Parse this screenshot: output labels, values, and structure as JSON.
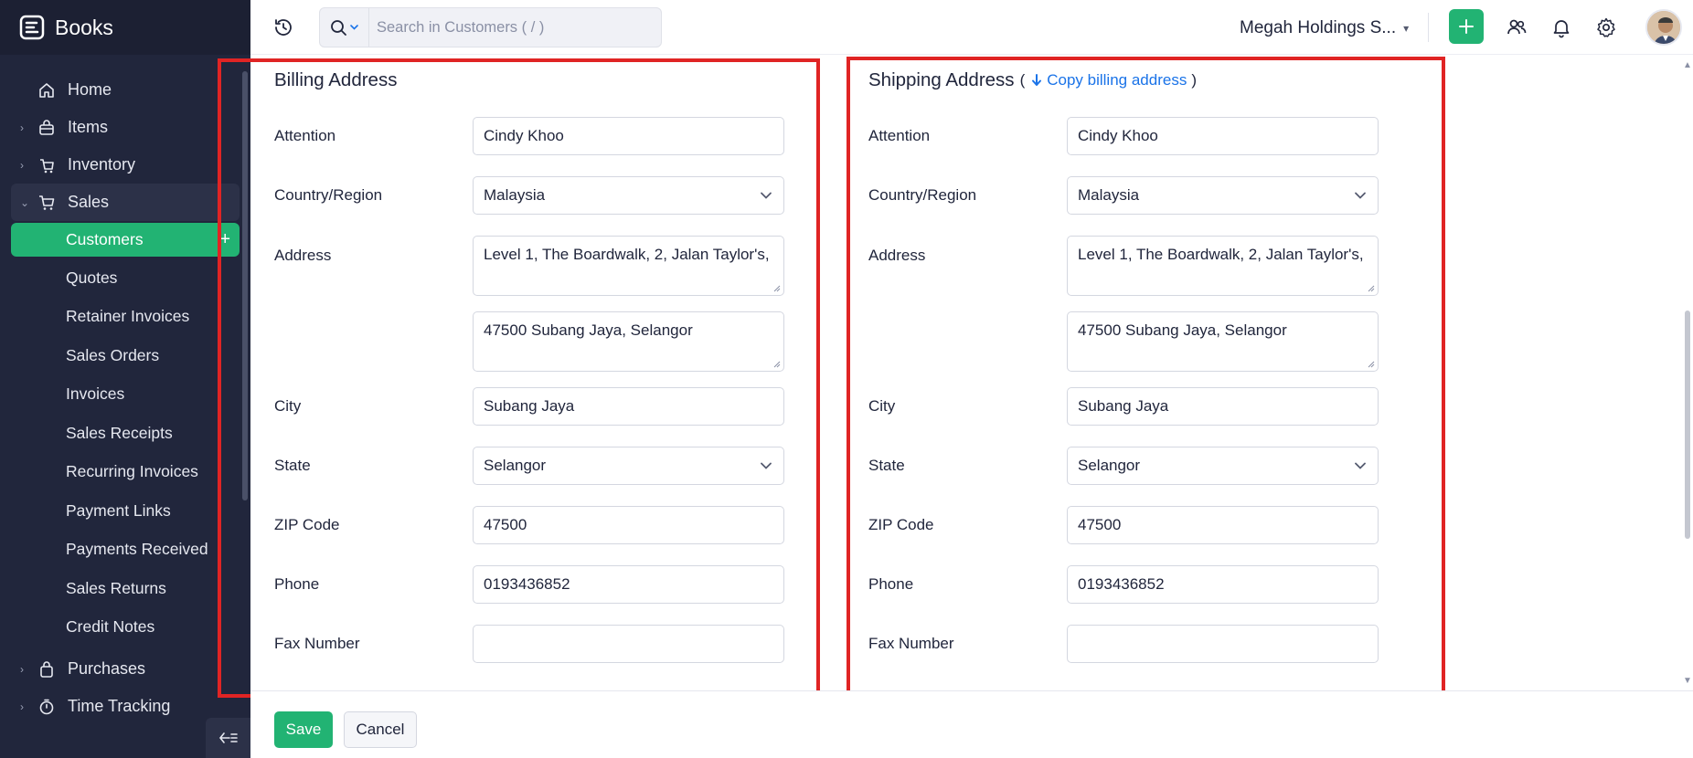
{
  "app": {
    "name": "Books"
  },
  "colors": {
    "accent": "#22b373",
    "sidebar_bg": "#21263c",
    "link": "#1a73e8",
    "highlight_box": "#e02424"
  },
  "sidebar": {
    "items": [
      {
        "label": "Home",
        "icon": "home-icon"
      },
      {
        "label": "Items",
        "icon": "basket-icon"
      },
      {
        "label": "Inventory",
        "icon": "box-icon"
      },
      {
        "label": "Sales",
        "icon": "cart-icon"
      },
      {
        "label": "Purchases",
        "icon": "bag-icon"
      },
      {
        "label": "Time Tracking",
        "icon": "timer-icon"
      }
    ],
    "sales_sub": [
      "Customers",
      "Quotes",
      "Retainer Invoices",
      "Sales Orders",
      "Invoices",
      "Sales Receipts",
      "Recurring Invoices",
      "Payment Links",
      "Payments Received",
      "Sales Returns",
      "Credit Notes"
    ],
    "add_symbol": "+"
  },
  "header": {
    "search_placeholder": "Search in Customers ( / )",
    "org_name": "Megah Holdings S..."
  },
  "billing": {
    "title": "Billing Address",
    "labels": {
      "attention": "Attention",
      "country": "Country/Region",
      "address": "Address",
      "city": "City",
      "state": "State",
      "zip": "ZIP Code",
      "phone": "Phone",
      "fax": "Fax Number"
    },
    "values": {
      "attention": "Cindy Khoo",
      "country": "Malaysia",
      "address1": "Level 1, The Boardwalk, 2, Jalan Taylor's,",
      "address2": "47500 Subang Jaya, Selangor",
      "city": "Subang Jaya",
      "state": "Selangor",
      "zip": "47500",
      "phone": "0193436852",
      "fax": ""
    }
  },
  "shipping": {
    "title": "Shipping Address",
    "paren_open": "(",
    "paren_close": ")",
    "copy_link": "Copy billing address",
    "labels": {
      "attention": "Attention",
      "country": "Country/Region",
      "address": "Address",
      "city": "City",
      "state": "State",
      "zip": "ZIP Code",
      "phone": "Phone",
      "fax": "Fax Number"
    },
    "values": {
      "attention": "Cindy Khoo",
      "country": "Malaysia",
      "address1": "Level 1, The Boardwalk, 2, Jalan Taylor's,",
      "address2": "47500 Subang Jaya, Selangor",
      "city": "Subang Jaya",
      "state": "Selangor",
      "zip": "47500",
      "phone": "0193436852",
      "fax": ""
    }
  },
  "footer": {
    "save_label": "Save",
    "cancel_label": "Cancel"
  }
}
